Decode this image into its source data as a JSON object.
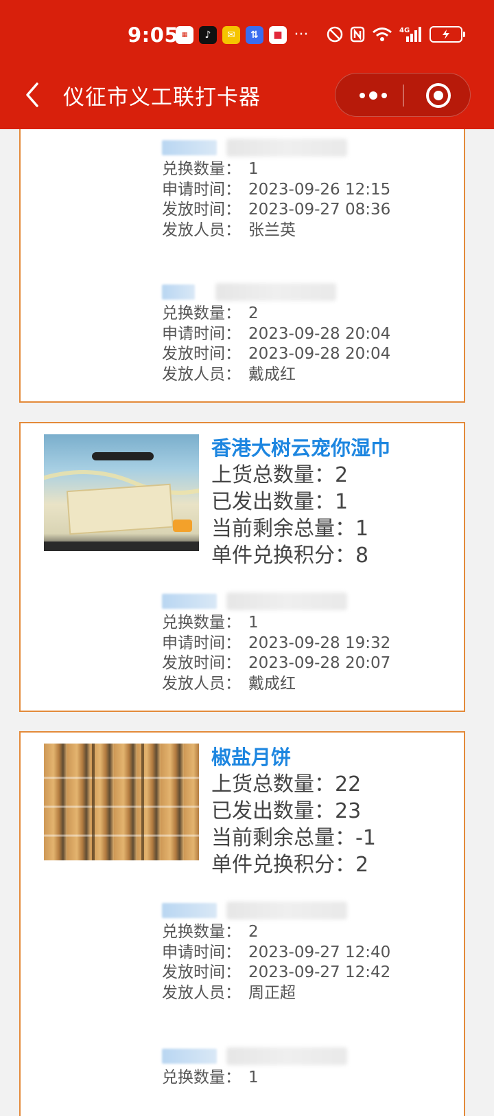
{
  "status_bar": {
    "time": "9:05",
    "network": "4G"
  },
  "nav": {
    "title": "仪征市义工联打卡器",
    "more_label": "•••"
  },
  "colors": {
    "header_red": "#d8200c",
    "card_border": "#e38a3a",
    "product_blue": "#1d86e0"
  },
  "labels": {
    "exchange_qty": "兑换数量：",
    "apply_time": "申请时间：",
    "issue_time": "发放时间：",
    "issuer": "发放人员：",
    "stock_total": "上货总数量：",
    "issued_total": "已发出数量：",
    "remaining": "当前剩余总量：",
    "points": "单件兑换积分："
  },
  "cards": [
    {
      "product": null,
      "records": [
        {
          "qty": "1",
          "apply": "2023-09-26 12:15",
          "issue": "2023-09-27 08:36",
          "issuer": "张兰英"
        },
        {
          "qty": "2",
          "apply": "2023-09-28 20:04",
          "issue": "2023-09-28 20:04",
          "issuer": "戴成红"
        }
      ]
    },
    {
      "product": {
        "name": "香港大树云宠你湿巾",
        "stock": "2",
        "issued": "1",
        "remaining": "1",
        "points": "8"
      },
      "records": [
        {
          "qty": "1",
          "apply": "2023-09-28 19:32",
          "issue": "2023-09-28 20:07",
          "issuer": "戴成红"
        }
      ]
    },
    {
      "product": {
        "name": "椒盐月饼",
        "stock": "22",
        "issued": "23",
        "remaining": "-1",
        "points": "2"
      },
      "records": [
        {
          "qty": "2",
          "apply": "2023-09-27 12:40",
          "issue": "2023-09-27 12:42",
          "issuer": "周正超"
        },
        {
          "qty": "1"
        }
      ]
    }
  ]
}
